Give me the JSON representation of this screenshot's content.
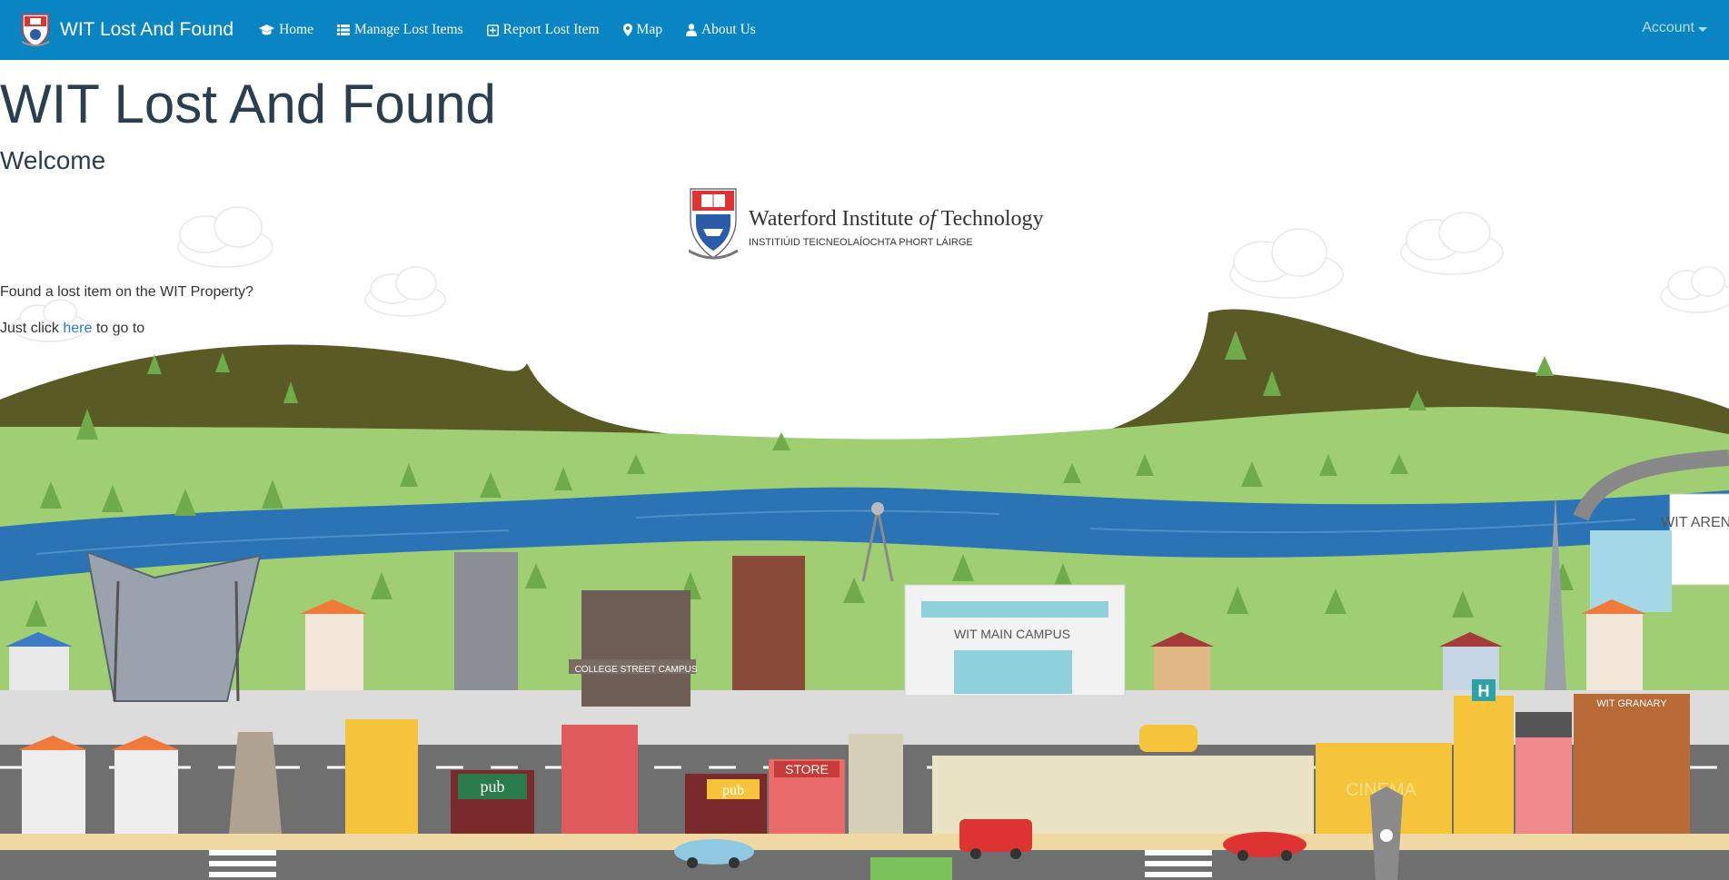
{
  "navbar": {
    "brand": "WIT Lost And Found",
    "items": [
      {
        "label": "Home",
        "icon": "graduation-cap-icon"
      },
      {
        "label": "Manage Lost Items",
        "icon": "list-icon"
      },
      {
        "label": "Report Lost Item",
        "icon": "plus-square-icon"
      },
      {
        "label": "Map",
        "icon": "map-marker-icon"
      },
      {
        "label": "About Us",
        "icon": "user-icon"
      }
    ],
    "account": "Account"
  },
  "hero": {
    "title": "WIT Lost And Found",
    "subtitle": "Welcome",
    "logo_name": "Waterford Institute",
    "logo_of": "of",
    "logo_tech": "Technology",
    "logo_irish": "INSTITIÚID TEICNEOLAÍOCHTA PHORT LÁIRGE",
    "question": "Found a lost item on the WIT Property?",
    "click_prefix": "Just click ",
    "click_link": "here",
    "click_suffix": " to go to"
  },
  "scene_labels": {
    "arena": "WIT ARENA",
    "main_campus": "WIT MAIN CAMPUS",
    "college_street": "COLLEGE STREET CAMPUS",
    "granary": "WIT GRANARY",
    "store": "STORE",
    "cinema": "CINEMA",
    "pub": "pub",
    "hospital": "H"
  },
  "colors": {
    "navbar": "#0885c2",
    "title": "#2b3e50",
    "link": "#2a7ec3",
    "hill_dark": "#5a5a24",
    "grass": "#9fcf72",
    "river": "#2a73b4",
    "road": "#6f6f6f",
    "pavement": "#d9d9d9"
  }
}
